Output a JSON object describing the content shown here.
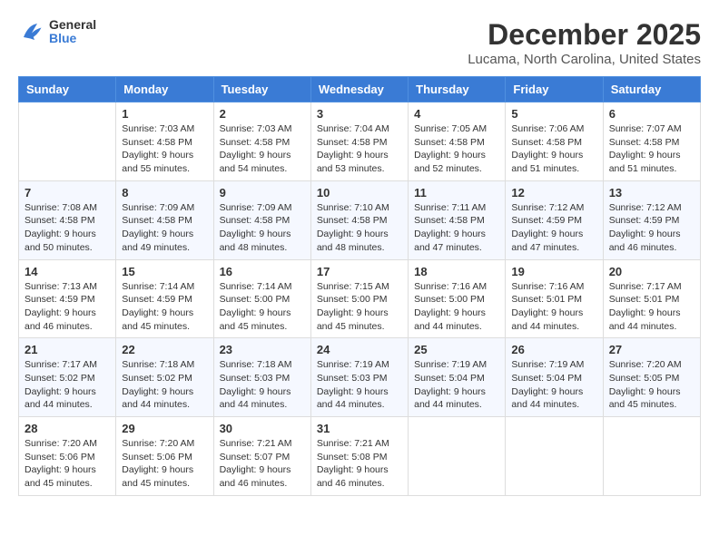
{
  "header": {
    "logo": {
      "line1": "General",
      "line2": "Blue"
    },
    "title": "December 2025",
    "location": "Lucama, North Carolina, United States"
  },
  "days_of_week": [
    "Sunday",
    "Monday",
    "Tuesday",
    "Wednesday",
    "Thursday",
    "Friday",
    "Saturday"
  ],
  "weeks": [
    [
      {
        "day": "",
        "info": ""
      },
      {
        "day": "1",
        "info": "Sunrise: 7:03 AM\nSunset: 4:58 PM\nDaylight: 9 hours\nand 55 minutes."
      },
      {
        "day": "2",
        "info": "Sunrise: 7:03 AM\nSunset: 4:58 PM\nDaylight: 9 hours\nand 54 minutes."
      },
      {
        "day": "3",
        "info": "Sunrise: 7:04 AM\nSunset: 4:58 PM\nDaylight: 9 hours\nand 53 minutes."
      },
      {
        "day": "4",
        "info": "Sunrise: 7:05 AM\nSunset: 4:58 PM\nDaylight: 9 hours\nand 52 minutes."
      },
      {
        "day": "5",
        "info": "Sunrise: 7:06 AM\nSunset: 4:58 PM\nDaylight: 9 hours\nand 51 minutes."
      },
      {
        "day": "6",
        "info": "Sunrise: 7:07 AM\nSunset: 4:58 PM\nDaylight: 9 hours\nand 51 minutes."
      }
    ],
    [
      {
        "day": "7",
        "info": "Sunrise: 7:08 AM\nSunset: 4:58 PM\nDaylight: 9 hours\nand 50 minutes."
      },
      {
        "day": "8",
        "info": "Sunrise: 7:09 AM\nSunset: 4:58 PM\nDaylight: 9 hours\nand 49 minutes."
      },
      {
        "day": "9",
        "info": "Sunrise: 7:09 AM\nSunset: 4:58 PM\nDaylight: 9 hours\nand 48 minutes."
      },
      {
        "day": "10",
        "info": "Sunrise: 7:10 AM\nSunset: 4:58 PM\nDaylight: 9 hours\nand 48 minutes."
      },
      {
        "day": "11",
        "info": "Sunrise: 7:11 AM\nSunset: 4:58 PM\nDaylight: 9 hours\nand 47 minutes."
      },
      {
        "day": "12",
        "info": "Sunrise: 7:12 AM\nSunset: 4:59 PM\nDaylight: 9 hours\nand 47 minutes."
      },
      {
        "day": "13",
        "info": "Sunrise: 7:12 AM\nSunset: 4:59 PM\nDaylight: 9 hours\nand 46 minutes."
      }
    ],
    [
      {
        "day": "14",
        "info": "Sunrise: 7:13 AM\nSunset: 4:59 PM\nDaylight: 9 hours\nand 46 minutes."
      },
      {
        "day": "15",
        "info": "Sunrise: 7:14 AM\nSunset: 4:59 PM\nDaylight: 9 hours\nand 45 minutes."
      },
      {
        "day": "16",
        "info": "Sunrise: 7:14 AM\nSunset: 5:00 PM\nDaylight: 9 hours\nand 45 minutes."
      },
      {
        "day": "17",
        "info": "Sunrise: 7:15 AM\nSunset: 5:00 PM\nDaylight: 9 hours\nand 45 minutes."
      },
      {
        "day": "18",
        "info": "Sunrise: 7:16 AM\nSunset: 5:00 PM\nDaylight: 9 hours\nand 44 minutes."
      },
      {
        "day": "19",
        "info": "Sunrise: 7:16 AM\nSunset: 5:01 PM\nDaylight: 9 hours\nand 44 minutes."
      },
      {
        "day": "20",
        "info": "Sunrise: 7:17 AM\nSunset: 5:01 PM\nDaylight: 9 hours\nand 44 minutes."
      }
    ],
    [
      {
        "day": "21",
        "info": "Sunrise: 7:17 AM\nSunset: 5:02 PM\nDaylight: 9 hours\nand 44 minutes."
      },
      {
        "day": "22",
        "info": "Sunrise: 7:18 AM\nSunset: 5:02 PM\nDaylight: 9 hours\nand 44 minutes."
      },
      {
        "day": "23",
        "info": "Sunrise: 7:18 AM\nSunset: 5:03 PM\nDaylight: 9 hours\nand 44 minutes."
      },
      {
        "day": "24",
        "info": "Sunrise: 7:19 AM\nSunset: 5:03 PM\nDaylight: 9 hours\nand 44 minutes."
      },
      {
        "day": "25",
        "info": "Sunrise: 7:19 AM\nSunset: 5:04 PM\nDaylight: 9 hours\nand 44 minutes."
      },
      {
        "day": "26",
        "info": "Sunrise: 7:19 AM\nSunset: 5:04 PM\nDaylight: 9 hours\nand 44 minutes."
      },
      {
        "day": "27",
        "info": "Sunrise: 7:20 AM\nSunset: 5:05 PM\nDaylight: 9 hours\nand 45 minutes."
      }
    ],
    [
      {
        "day": "28",
        "info": "Sunrise: 7:20 AM\nSunset: 5:06 PM\nDaylight: 9 hours\nand 45 minutes."
      },
      {
        "day": "29",
        "info": "Sunrise: 7:20 AM\nSunset: 5:06 PM\nDaylight: 9 hours\nand 45 minutes."
      },
      {
        "day": "30",
        "info": "Sunrise: 7:21 AM\nSunset: 5:07 PM\nDaylight: 9 hours\nand 46 minutes."
      },
      {
        "day": "31",
        "info": "Sunrise: 7:21 AM\nSunset: 5:08 PM\nDaylight: 9 hours\nand 46 minutes."
      },
      {
        "day": "",
        "info": ""
      },
      {
        "day": "",
        "info": ""
      },
      {
        "day": "",
        "info": ""
      }
    ]
  ]
}
